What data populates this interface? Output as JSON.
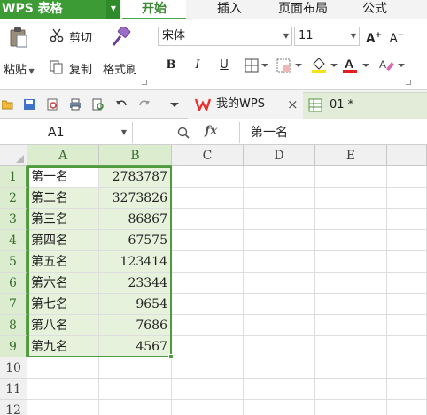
{
  "app": {
    "title": "WPS 表格"
  },
  "menu": {
    "tabs": [
      "开始",
      "插入",
      "页面布局",
      "公式"
    ],
    "active": "开始"
  },
  "ribbon": {
    "paste_label": "粘贴",
    "cut_label": "剪切",
    "copy_label": "复制",
    "format_painter_label": "格式刷",
    "font_name": "宋体",
    "font_size": "11",
    "bold": "B",
    "italic": "I",
    "underline": "U",
    "font_color": "#e02020",
    "highlight_color": "#f5e21a"
  },
  "doc_tabs": [
    {
      "label": "我的WPS",
      "close": "×"
    },
    {
      "label": "01 *"
    }
  ],
  "formula_bar": {
    "name_box": "A1",
    "fx": "fx",
    "content": "第一名"
  },
  "sheet": {
    "columns": [
      "A",
      "B",
      "C",
      "D",
      "E"
    ],
    "rows": [
      {
        "num": "1",
        "a": "第一名",
        "b": "2783787"
      },
      {
        "num": "2",
        "a": "第二名",
        "b": "3273826"
      },
      {
        "num": "3",
        "a": "第三名",
        "b": "86867"
      },
      {
        "num": "4",
        "a": "第四名",
        "b": "67575"
      },
      {
        "num": "5",
        "a": "第五名",
        "b": "123414"
      },
      {
        "num": "6",
        "a": "第六名",
        "b": "23344"
      },
      {
        "num": "7",
        "a": "第七名",
        "b": "9654"
      },
      {
        "num": "8",
        "a": "第八名",
        "b": "7686"
      },
      {
        "num": "9",
        "a": "第九名",
        "b": "4567"
      },
      {
        "num": "10",
        "a": "",
        "b": ""
      },
      {
        "num": "11",
        "a": "",
        "b": ""
      },
      {
        "num": "12",
        "a": "",
        "b": ""
      }
    ],
    "selection": "A1:B9",
    "accent_color": "#4f9a3e"
  }
}
